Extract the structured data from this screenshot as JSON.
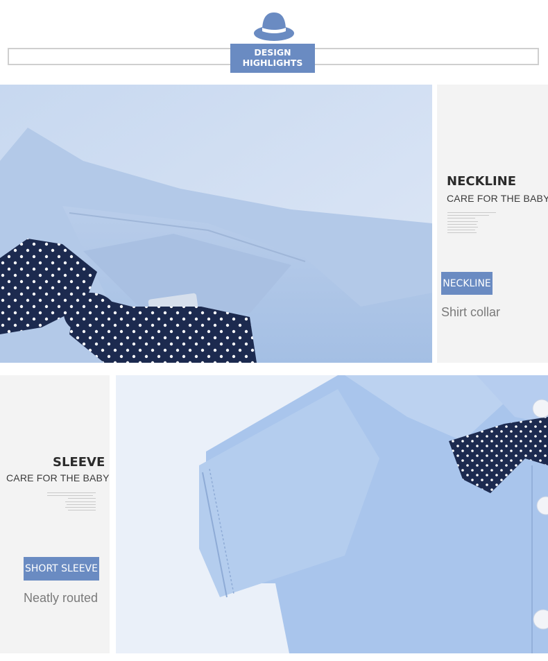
{
  "header": {
    "badge_line1": "DESIGN",
    "badge_line2": "HIGHLIGHTS",
    "icon": "hat-icon"
  },
  "neckline": {
    "title": "NECKLINE",
    "subtitle": "CARE FOR THE BABY",
    "tag": "NECKLINE",
    "caption": "Shirt collar"
  },
  "sleeve": {
    "title": "SLEEVE",
    "subtitle": "CARE FOR THE BABY",
    "tag": "SHORT SLEEVE",
    "caption": "Neatly routed"
  },
  "colors": {
    "accent": "#6a8bc2",
    "shirt": "#a9c3e8",
    "bowtie": "#1c2a4f"
  }
}
